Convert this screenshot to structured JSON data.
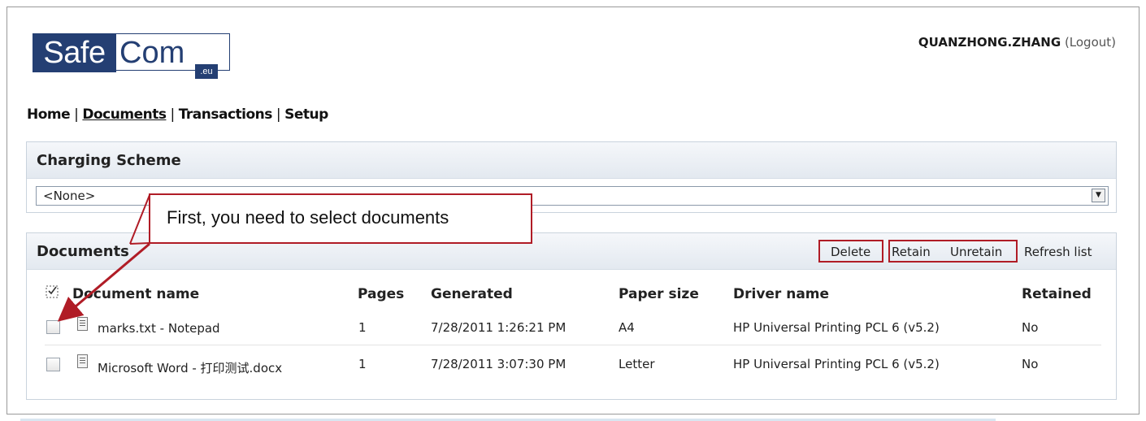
{
  "logo": {
    "part1": "Safe",
    "part2": "Com",
    "suffix": ".eu"
  },
  "user": {
    "name": "QUANZHONG.ZHANG",
    "logout": "(Logout)"
  },
  "nav": {
    "items": [
      "Home",
      "Documents",
      "Transactions",
      "Setup"
    ],
    "current": "Documents"
  },
  "charging": {
    "title": "Charging Scheme",
    "selected": "<None>"
  },
  "documents": {
    "title": "Documents",
    "actions": {
      "delete": "Delete",
      "retain": "Retain",
      "unretain": "Unretain",
      "refresh": "Refresh list"
    },
    "columns": [
      "Document name",
      "Pages",
      "Generated",
      "Paper size",
      "Driver name",
      "Retained"
    ],
    "rows": [
      {
        "name": "marks.txt - Notepad",
        "pages": "1",
        "generated": "7/28/2011 1:26:21 PM",
        "paper": "A4",
        "driver": "HP Universal Printing PCL 6 (v5.2)",
        "retained": "No"
      },
      {
        "name": "Microsoft Word - 打印测试.docx",
        "pages": "1",
        "generated": "7/28/2011 3:07:30 PM",
        "paper": "Letter",
        "driver": "HP Universal Printing PCL 6 (v5.2)",
        "retained": "No"
      }
    ]
  },
  "callout": {
    "text": "First, you need to select documents"
  },
  "colors": {
    "brand": "#243f73",
    "highlight": "#b01c26",
    "header_bg": "#e3e9f0"
  }
}
